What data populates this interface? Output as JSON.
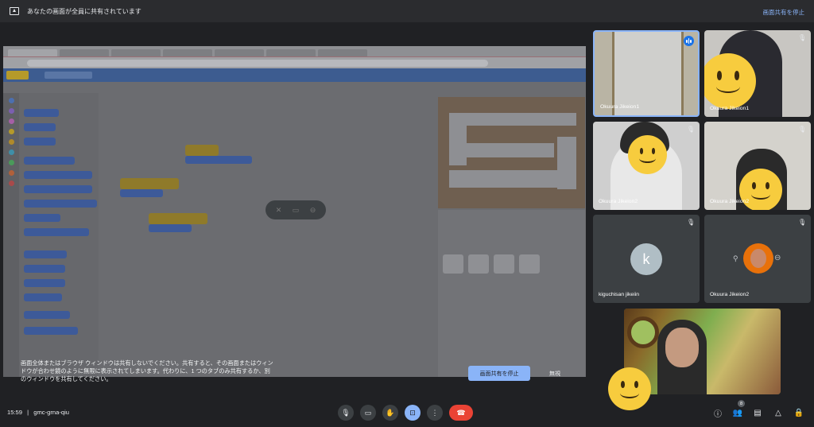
{
  "banner": {
    "message": "あなたの画面が全員に共有されています",
    "stop_link": "画面共有を停止"
  },
  "shared_screen": {
    "warning_text": "画面全体またはブラウザ ウィンドウは共有しないでください。共有すると、その画面またはウィンドウが合わせ鏡のように無限に表示されてしまいます。代わりに、1 つのタブのみ共有するか、別のウィンドウを共有してください。",
    "stop_button": "画面共有を停止",
    "ignore_button": "無視"
  },
  "participants": [
    {
      "name": "Okuura Jikeion1",
      "speaking": true
    },
    {
      "name": "Okuura Jikeion1",
      "speaking": false
    },
    {
      "name": "Okuura Jikeion2",
      "speaking": false
    },
    {
      "name": "Okuura Jikeion2",
      "speaking": false
    },
    {
      "name": "kiguchisan jikeiin",
      "initial": "k",
      "speaking": false
    },
    {
      "name": "Okuura Jikeion2",
      "speaking": false
    }
  ],
  "bottom_bar": {
    "time": "15:59",
    "separator": "|",
    "meeting_code": "gmc-grna-qiu",
    "participant_count": "8"
  },
  "icons": {
    "mic": "mic-icon",
    "camera": "camera-icon",
    "hand": "raise-hand-icon",
    "present": "present-icon",
    "more": "more-options-icon",
    "leave": "leave-call-icon",
    "info": "info-icon",
    "people": "people-icon",
    "chat": "chat-icon",
    "activities": "activities-icon",
    "host": "host-controls-icon"
  },
  "colors": {
    "background": "#202124",
    "accent": "#8ab4f8",
    "leave": "#ea4335",
    "smiley": "#f7cc3e"
  }
}
